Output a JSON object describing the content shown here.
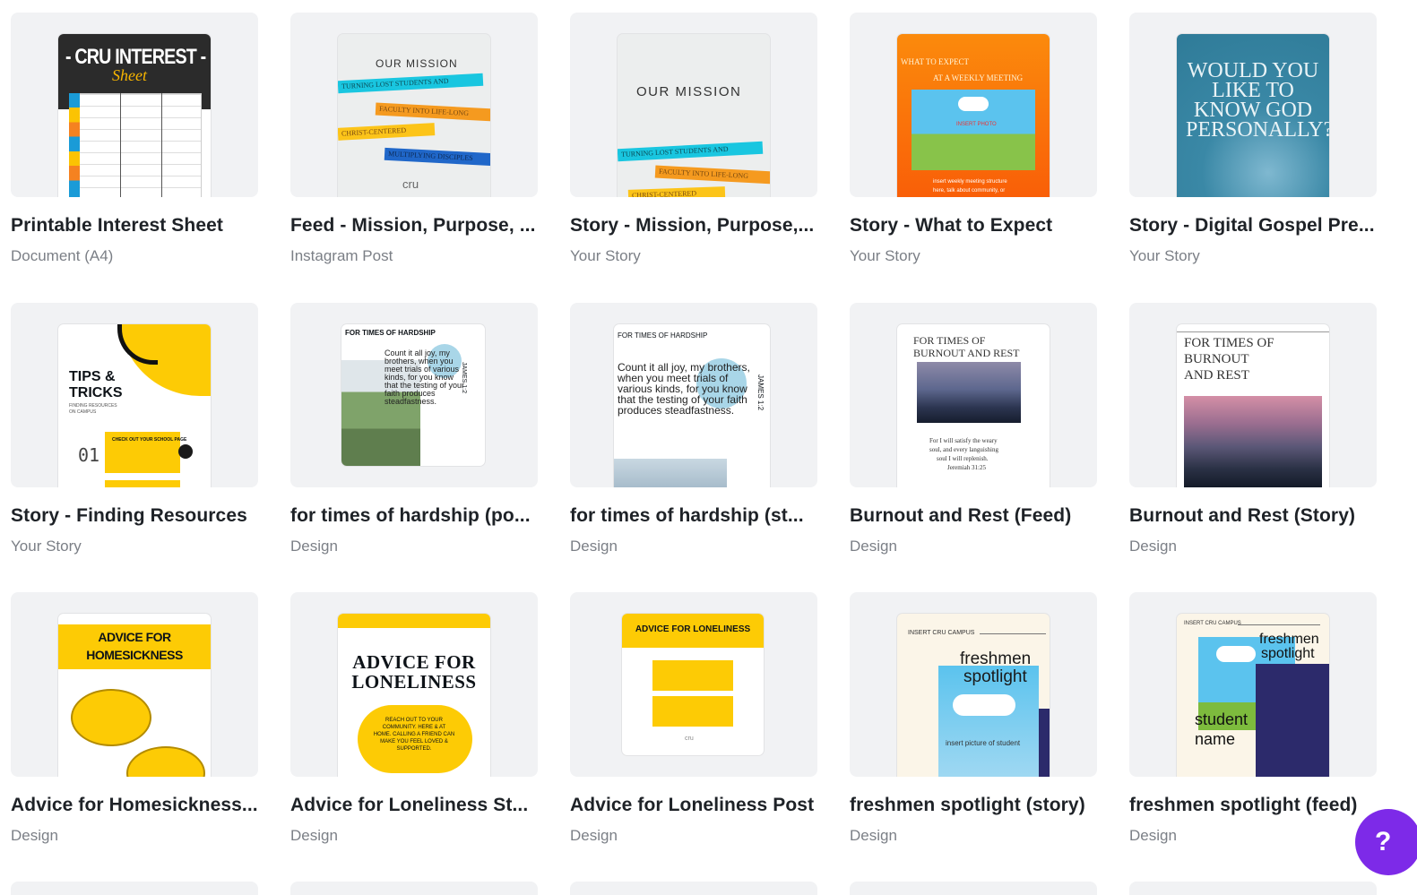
{
  "designs": [
    {
      "title": "Printable Interest Sheet",
      "type": "Document (A4)"
    },
    {
      "title": "Feed - Mission, Purpose, ...",
      "type": "Instagram Post"
    },
    {
      "title": "Story - Mission, Purpose,...",
      "type": "Your Story"
    },
    {
      "title": "Story - What to Expect",
      "type": "Your Story"
    },
    {
      "title": "Story - Digital Gospel Pre...",
      "type": "Your Story"
    },
    {
      "title": "Story - Finding Resources",
      "type": "Your Story"
    },
    {
      "title": "for times of hardship (po...",
      "type": "Design"
    },
    {
      "title": "for times of hardship (st...",
      "type": "Design"
    },
    {
      "title": "Burnout and Rest (Feed)",
      "type": "Design"
    },
    {
      "title": "Burnout and Rest (Story)",
      "type": "Design"
    },
    {
      "title": "Advice for Homesickness...",
      "type": "Design"
    },
    {
      "title": "Advice for Loneliness St...",
      "type": "Design"
    },
    {
      "title": "Advice for Loneliness Post",
      "type": "Design"
    },
    {
      "title": "freshmen spotlight (story)",
      "type": "Design"
    },
    {
      "title": "freshmen spotlight (feed)",
      "type": "Design"
    }
  ],
  "thumbs": {
    "interest": {
      "banner": "- CRU INTEREST -",
      "script": "Sheet"
    },
    "mission_feed": {
      "heading": "OUR MISSION",
      "l1": "TURNING LOST STUDENTS AND",
      "l2": "FACULTY INTO LIFE-LONG",
      "l3": "CHRIST-CENTERED",
      "l4": "MULTIPLYING DISCIPLES",
      "logo": "cru"
    },
    "mission_story": {
      "heading": "OUR MISSION",
      "l1": "TURNING LOST STUDENTS AND",
      "l2": "FACULTY INTO LIFE-LONG",
      "l3": "CHRIST-CENTERED"
    },
    "expect": {
      "line1": "WHAT TO EXPECT",
      "line2": "AT A WEEKLY MEETING",
      "photo": "INSERT PHOTO",
      "foot1": "insert weekly meeting structure",
      "foot2": "here, talk about community, or"
    },
    "gospel": {
      "text": "WOULD YOU LIKE TO KNOW GOD PERSONALLY?"
    },
    "resources": {
      "title1": "TIPS &",
      "title2": "TRICKS",
      "sub1": "FINDING RESOURCES",
      "sub2": "ON CAMPUS",
      "num": "01",
      "box1": "CHECK OUT YOUR SCHOOL PAGE"
    },
    "hardship_post": {
      "heading": "FOR TIMES OF HARDSHIP",
      "verse": "Count it all joy, my brothers, when you meet trials of various kinds, for you know that the testing of your faith produces steadfastness.",
      "ref": "JAMES 1:2"
    },
    "hardship_story": {
      "heading": "FOR TIMES OF HARDSHIP",
      "verse": "Count it all joy, my brothers, when you meet trials of various kinds, for you know that the testing of your faith produces steadfastness.",
      "ref": "JAMES 1:2"
    },
    "burnout_feed": {
      "heading1": "FOR TIMES OF",
      "heading2": "BURNOUT AND REST",
      "verse1": "For I will satisfy the weary",
      "verse2": "soul, and every languishing",
      "verse3": "soul I will replenish.",
      "ref": "Jeremiah 31:25"
    },
    "burnout_story": {
      "heading1": "FOR TIMES OF",
      "heading2": "BURNOUT",
      "heading3": "AND REST"
    },
    "homesick": {
      "title1": "ADVICE FOR",
      "title2": "HOMESICKNESS"
    },
    "lonely_story": {
      "title1": "ADVICE FOR",
      "title2": "LONELINESS",
      "body1": "REACH OUT TO YOUR",
      "body2": "COMMUNITY. HERE & AT",
      "body3": "HOME. CALLING A FRIEND CAN",
      "body4": "MAKE YOU FEEL LOVED &",
      "body5": "SUPPORTED."
    },
    "lonely_post": {
      "title": "ADVICE FOR LONELINESS",
      "logo": "cru"
    },
    "spot_story": {
      "campus": "INSERT CRU CAMPUS",
      "t1": "freshmen",
      "t2": "spotlight",
      "pic": "insert picture of student"
    },
    "spot_feed": {
      "campus": "INSERT CRU CAMPUS",
      "t1": "freshmen",
      "t2": "spotlight",
      "n1": "student",
      "n2": "name"
    }
  },
  "help": {
    "label": "?"
  },
  "colors": {
    "accent": "#7d2ae8",
    "yellow": "#fdcb05",
    "teal": "#3a88a6",
    "orange": "#fa6a0a"
  }
}
